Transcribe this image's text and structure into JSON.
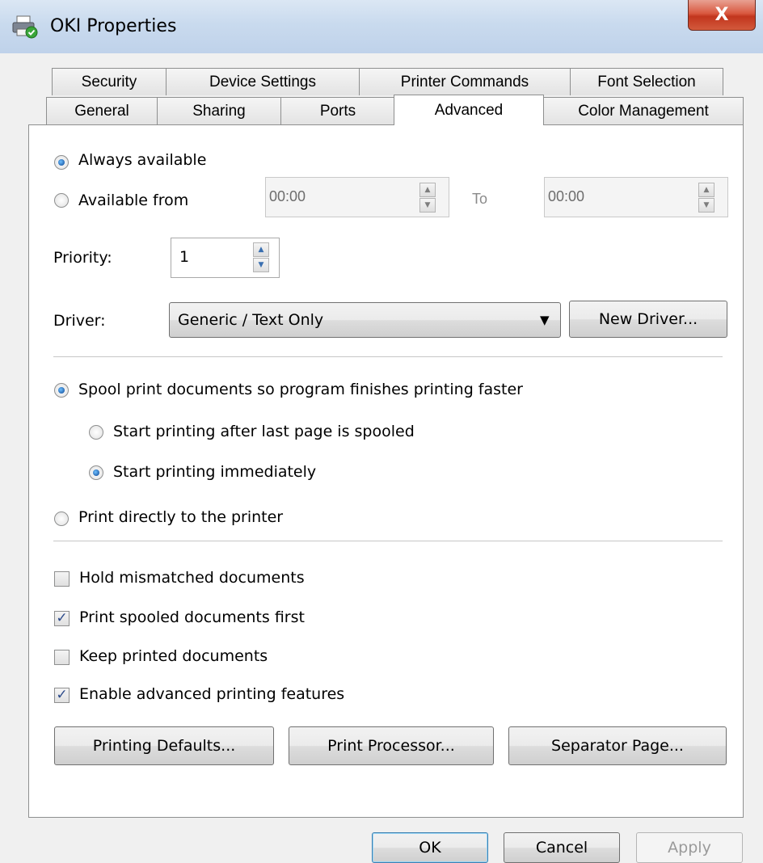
{
  "window": {
    "title": "OKI Properties",
    "close_glyph": "X"
  },
  "tabs": {
    "row_back": [
      "Security",
      "Device Settings",
      "Printer Commands",
      "Font Selection"
    ],
    "row_front": [
      "General",
      "Sharing",
      "Ports",
      "Advanced",
      "Color Management"
    ],
    "active": "Advanced"
  },
  "availability": {
    "always_label": "Always available",
    "from_label": "Available from",
    "from_time": "00:00",
    "to_label": "To",
    "to_time": "00:00",
    "selected": "always"
  },
  "priority": {
    "label": "Priority:",
    "value": "1"
  },
  "driver": {
    "label": "Driver:",
    "value": "Generic / Text Only",
    "new_driver_label": "New Driver..."
  },
  "spool": {
    "spool_label": "Spool print documents so program finishes printing faster",
    "after_last_label": "Start printing after last page is spooled",
    "immediately_label": "Start printing immediately",
    "direct_label": "Print directly to the printer",
    "selected": "spool",
    "sub_selected": "immediately"
  },
  "options": [
    {
      "label": "Hold mismatched documents",
      "checked": false
    },
    {
      "label": "Print spooled documents first",
      "checked": true
    },
    {
      "label": "Keep printed documents",
      "checked": false
    },
    {
      "label": "Enable advanced printing features",
      "checked": true
    }
  ],
  "panel_buttons": {
    "printing_defaults": "Printing Defaults...",
    "print_processor": "Print Processor...",
    "separator_page": "Separator Page..."
  },
  "footer": {
    "ok": "OK",
    "cancel": "Cancel",
    "apply": "Apply"
  },
  "icons": {
    "app": "printer-icon",
    "check": "✓",
    "spin_up": "▲",
    "spin_down": "▼",
    "dropdown": "▼"
  }
}
